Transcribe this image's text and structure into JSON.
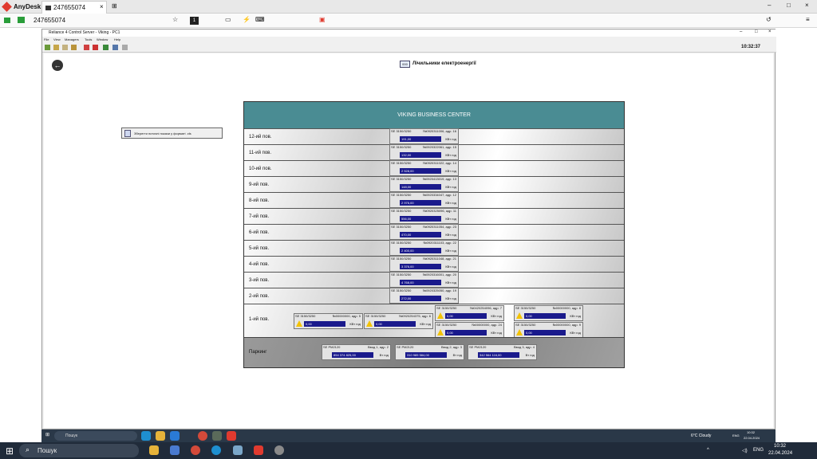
{
  "anydesk": {
    "app_name": "AnyDesk",
    "tab_title": "247655074",
    "address": "247655074",
    "session_number": "1"
  },
  "remote": {
    "window_title": "Reliance 4 Control Server - Viking - PC1",
    "menu": [
      "File",
      "View",
      "Managers",
      "Tools",
      "Window",
      "Help"
    ],
    "clock": "10:32:37",
    "page_title": "Лічильники електроенергії",
    "export_button": "Зберегти поточні покази у форматі .xls",
    "building": "VIKING BUSINESS CENTER",
    "floors": [
      {
        "label": "12-ий пов.",
        "model": "SE 3150/3250",
        "serial": "№0920311006, адр. 16",
        "value": "191,00",
        "unit": "КВт год"
      },
      {
        "label": "11-ий пов.",
        "model": "SE 3150/3250",
        "serial": "№0920322061, адр. 15",
        "value": "132,00",
        "unit": "КВт год"
      },
      {
        "label": "10-ий пов.",
        "model": "SE 3150/3250",
        "serial": "№0920311022, адр. 14",
        "value": "2 528,00",
        "unit": "КВт год"
      },
      {
        "label": "9-ий пов.",
        "model": "SE 3150/3250",
        "serial": "№0920413019, адр. 13",
        "value": "148,00",
        "unit": "КВт год"
      },
      {
        "label": "8-ий пов.",
        "model": "SE 3150/3250",
        "serial": "№0920334047, адр. 12",
        "value": "2 976,00",
        "unit": "КВт год"
      },
      {
        "label": "7-ий пов.",
        "model": "SE 3150/3250",
        "serial": "№0920325096, адр. 11",
        "value": "556,00",
        "unit": "КВт год"
      },
      {
        "label": "6-ий пов.",
        "model": "SE 3150/3250",
        "serial": "№0920311054, адр. 23",
        "value": "470,00",
        "unit": "КВт год"
      },
      {
        "label": "5-ий пов.",
        "model": "SE 3150/3250",
        "serial": "№0920311103, адр. 22",
        "value": "2 400,00",
        "unit": "КВт год"
      },
      {
        "label": "4-ий пов.",
        "model": "SE 3150/3250",
        "serial": "№0920311048, адр. 21",
        "value": "3 376,00",
        "unit": "КВт год"
      },
      {
        "label": "3-ий пов.",
        "model": "SE 3150/3250",
        "serial": "№0920316001, адр. 20",
        "value": "4 768,00",
        "unit": "КВт год"
      },
      {
        "label": "2-ий пов.",
        "model": "SE 3150/3250",
        "serial": "№0920325050, адр. 19",
        "value": "272,00",
        "unit": "КВт год"
      }
    ],
    "floor1": {
      "label": "1-ий пов.",
      "meters": [
        {
          "model": "SE 3150/3250",
          "serial": "№00000000, адр. 5",
          "value": "0,00",
          "unit": "КВт год"
        },
        {
          "model": "SE 3150/3250",
          "serial": "№0920254375, адр. 6",
          "value": "0,00",
          "unit": "КВт год"
        },
        {
          "model": "SE 3150/3250",
          "serial": "№0420254096, адр. 7",
          "value": "0,00",
          "unit": "КВт год"
        },
        {
          "model": "SE 3150/3250",
          "serial": "№00000000, адр. 8",
          "value": "0,00",
          "unit": "КВт год"
        },
        {
          "model": "SE 3150/3250",
          "serial": "№00000000, адр. 24",
          "value": "0,00",
          "unit": "КВт год"
        },
        {
          "model": "SE 3150/3250",
          "serial": "№00000000, адр. 9",
          "value": "0,00",
          "unit": "КВт год"
        }
      ]
    },
    "parking": {
      "label": "Паркинг",
      "meters": [
        {
          "model": "SE PM2120",
          "input": "Ввод 1, адр. 2",
          "value": "854 374 825,00",
          "unit": "Вт год"
        },
        {
          "model": "SE PM2120",
          "input": "Ввод 2, адр. 3",
          "value": "310 985 584,00",
          "unit": "Вт год"
        },
        {
          "model": "SE PM2120",
          "input": "Ввод 3, адр. 4",
          "value": "342 564 116,00",
          "unit": "Вт год"
        }
      ]
    }
  },
  "inner_taskbar": {
    "search": "Пошук",
    "weather": "6°C Cloudy",
    "lang": "ENG",
    "time": "10:32",
    "date": "22.04.2024"
  },
  "taskbar": {
    "search": "Пошук",
    "lang": "ENG",
    "time": "10:32",
    "date": "22.04.2024"
  },
  "colors": {
    "header": "#4a8c93",
    "value_bg": "#1a1a8c",
    "anydesk_red": "#e03a2f"
  }
}
